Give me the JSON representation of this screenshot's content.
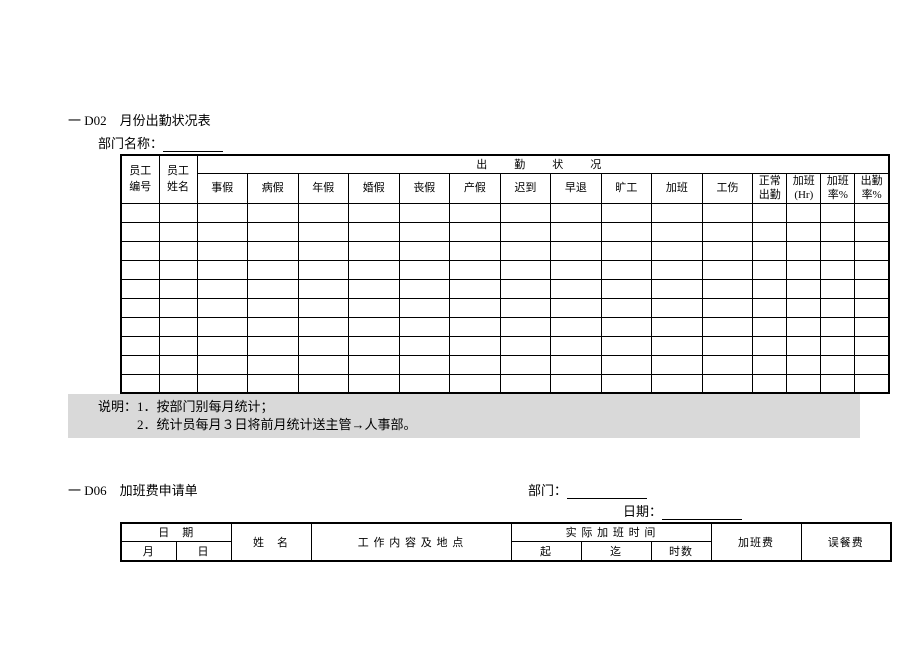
{
  "section1": {
    "heading": "一 D02　月份出勤状况表",
    "dept_label": "部门名称：",
    "table": {
      "col_emp_id": "员工\n编号",
      "col_emp_name": "员工\n姓名",
      "attendance_header": "出　勤　状　况",
      "cols": [
        "事假",
        "病假",
        "年假",
        "婚假",
        "丧假",
        "产假",
        "迟到",
        "早退",
        "旷工",
        "加班",
        "工伤",
        "正常\n出勤",
        "加班\n(Hr)",
        "加班\n率%",
        "出勤\n率%"
      ]
    },
    "notes_line1": "说明：1．按部门别每月统计；",
    "notes_line2": "　　　2．统计员每月３日将前月统计送主管→人事部。"
  },
  "section2": {
    "heading": "一 D06　加班费申请单",
    "dept_label": "部门：",
    "date_label": "日期：",
    "table": {
      "date_hdr": "日　期",
      "month": "月",
      "day": "日",
      "name": "姓　名",
      "work_content": "工 作 内 容 及 地 点",
      "actual_ot": "实 际 加 班 时 间",
      "from": "起",
      "to": "迄",
      "hours": "时数",
      "ot_fee": "加班费",
      "meal_fee": "误餐费"
    }
  }
}
